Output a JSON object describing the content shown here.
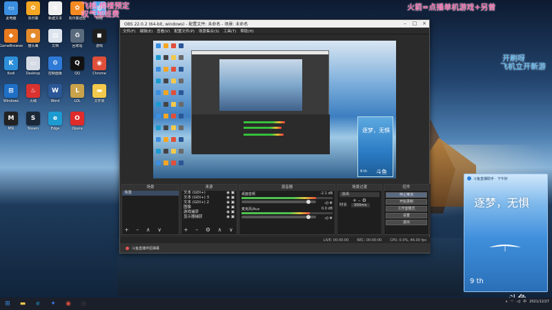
{
  "overlay_texts": {
    "top_left_line1": "飞桃-倚楼预定",
    "top_left_line2": "叹气加班费",
    "top_right": "火箭=点播单机游戏+另曾",
    "right_line1": "开刷呀",
    "right_line2": "飞机立开新游"
  },
  "desktop_icons": [
    {
      "label": "此电脑",
      "icon": "computer-icon",
      "color": "#3c8fe0",
      "glyph": "▭"
    },
    {
      "label": "向日葵",
      "icon": "sunflower-icon",
      "color": "#f5a623",
      "glyph": "✿"
    },
    {
      "label": "新建文本",
      "icon": "text-file-icon",
      "color": "#f0f0f0",
      "glyph": "≡"
    },
    {
      "label": "向日葵远控",
      "icon": "sunflower-remote-icon",
      "color": "#f58a23",
      "glyph": "✿"
    },
    {
      "label": "网络",
      "icon": "network-icon",
      "color": "#4aa3ea",
      "glyph": "◍"
    },
    {
      "label": "GameBrowser",
      "icon": "game-browser-icon",
      "color": "#e87a1f",
      "glyph": "◆"
    },
    {
      "label": "猫头鹰",
      "icon": "owl-icon",
      "color": "#e58a2b",
      "glyph": "●"
    },
    {
      "label": "文档",
      "icon": "document-icon",
      "color": "#dde4ee",
      "glyph": "▤"
    },
    {
      "label": "回收站",
      "icon": "recycle-bin-icon",
      "color": "#5a6b7e",
      "glyph": "♻"
    },
    {
      "label": "游戏",
      "icon": "game-icon",
      "color": "#1e1e1e",
      "glyph": "◼"
    },
    {
      "label": "Kodi",
      "icon": "kodi-icon",
      "color": "#2d8fd9",
      "glyph": "K"
    },
    {
      "label": "Desktop",
      "icon": "desktop-shortcut-icon",
      "color": "#d4dbe5",
      "glyph": "▭"
    },
    {
      "label": "控制面板",
      "icon": "control-panel-icon",
      "color": "#2e7ad6",
      "glyph": "⚙"
    },
    {
      "label": "QQ",
      "icon": "qq-icon",
      "color": "#111",
      "glyph": "Q"
    },
    {
      "label": "Chrome",
      "icon": "chrome-icon",
      "color": "#e04f3a",
      "glyph": "◉"
    },
    {
      "label": "Windows",
      "icon": "windows-icon",
      "color": "#1f6fc5",
      "glyph": "⊞"
    },
    {
      "label": "火绒",
      "icon": "huorong-icon",
      "color": "#d9322f",
      "glyph": "♨"
    },
    {
      "label": "Word",
      "icon": "word-icon",
      "color": "#2b5797",
      "glyph": "W"
    },
    {
      "label": "LOL",
      "icon": "lol-icon",
      "color": "#c9a24a",
      "glyph": "L"
    },
    {
      "label": "文件夹",
      "icon": "folder-icon",
      "color": "#f2c94c",
      "glyph": "▬"
    },
    {
      "label": "MSI",
      "icon": "msi-icon",
      "color": "#222",
      "glyph": "M"
    },
    {
      "label": "Steam",
      "icon": "steam-icon",
      "color": "#1b2838",
      "glyph": "S"
    },
    {
      "label": "Edge",
      "icon": "edge-icon",
      "color": "#1d9bd1",
      "glyph": "e"
    },
    {
      "label": "Opera",
      "icon": "opera-icon",
      "color": "#e02b2b",
      "glyph": "O"
    }
  ],
  "obs": {
    "title": "OBS 22.0.2 (64-bit, windows) - 配置文件: 未命名 - 场景: 未命名",
    "menu": [
      "文件(F)",
      "编辑(E)",
      "查看(V)",
      "配置文件(P)",
      "场景集合(S)",
      "工具(T)",
      "帮助(H)"
    ],
    "docks": {
      "scenes_header": "场景",
      "scenes": [
        "场景"
      ],
      "sources_header": "来源",
      "sources": [
        "文本 (GDI+)",
        "文本 (GDI+) 3",
        "文本 (GDI+) 2",
        "图像",
        "游戏捕获",
        "显示器捕获"
      ],
      "mixer_header": "混音器",
      "mixer": [
        {
          "name": "桌面音频",
          "db": "-2.1 dB",
          "level": 0.82,
          "volume": 0.92
        },
        {
          "name": "麦克风/Aux",
          "db": "0.0 dB",
          "level": 0.75,
          "volume": 0.92
        }
      ],
      "transitions_header": "场景过渡",
      "transition_type": "淡出",
      "duration_label": "时长",
      "duration_value": "300ms",
      "controls_header": "控件",
      "controls": [
        "停止推流",
        "开始录制",
        "工作室模式",
        "设置",
        "退出"
      ]
    },
    "status": {
      "live": "LIVE: 00:00:00",
      "rec": "REC: 00:00:00",
      "cpu": "CPU: 0.0%, 46.00 fps"
    },
    "bottom_bar": "斗鱼直播伴侣弹幕"
  },
  "live_card": {
    "header": "斗鱼直播助手 · 下午好",
    "title": "逐梦，无惧",
    "day": "9 th"
  },
  "taskbar": {
    "icons": [
      {
        "icon": "windows-start-icon",
        "glyph": "⊞",
        "color": "#3a8ee6"
      },
      {
        "icon": "file-explorer-icon",
        "glyph": "▬",
        "color": "#f2c94c"
      },
      {
        "icon": "edge-browser-icon",
        "glyph": "e",
        "color": "#1d9bd1"
      },
      {
        "icon": "bird-app-icon",
        "glyph": "✦",
        "color": "#3a7be8"
      },
      {
        "icon": "chrome-browser-icon",
        "glyph": "◉",
        "color": "#e04f3a"
      },
      {
        "icon": "obs-app-icon",
        "glyph": "◎",
        "color": "#444"
      }
    ],
    "time": "",
    "date": "2021/12/27"
  },
  "watermark": "斗鱼"
}
